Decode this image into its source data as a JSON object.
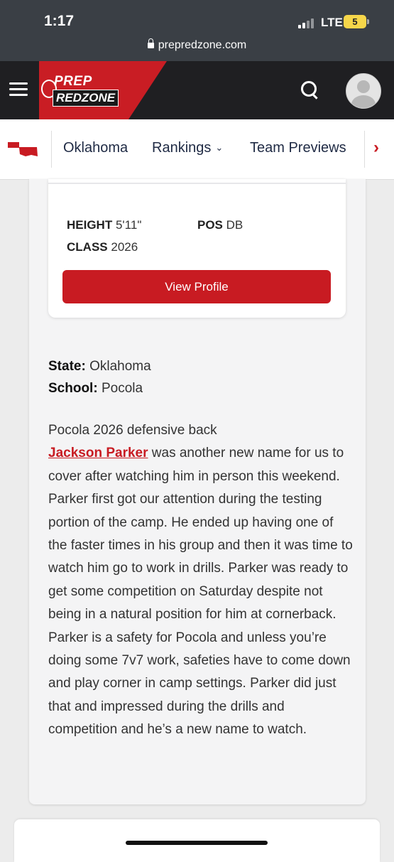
{
  "status_bar": {
    "time": "1:17",
    "network": "LTE",
    "battery": "5",
    "url": "prepredzone.com"
  },
  "header": {
    "logo_line1": "PREP",
    "logo_line2": "REDZONE",
    "brand_red": "#c91d24"
  },
  "subnav": {
    "state_icon": "oklahoma-state-icon",
    "items": [
      "Oklahoma",
      "Rankings",
      "Team Previews"
    ],
    "rankings_chevron": "⌄",
    "next_arrow": "›"
  },
  "player_card": {
    "height_label": "HEIGHT",
    "height_value": "5'11\"",
    "pos_label": "POS",
    "pos_value": "DB",
    "class_label": "CLASS",
    "class_value": "2026",
    "button_label": "View Profile"
  },
  "article": {
    "state_label": "State:",
    "state_value": "Oklahoma",
    "school_label": "School:",
    "school_value": "Pocola",
    "intro": "Pocola 2026 defensive back",
    "player_name": "Jackson Parker",
    "body": " was another new name for us to cover after watching him in person this weekend. Parker first got our attention during the testing portion of the camp. He ended up having one of the faster times in his group and then it was time to watch him go to work in drills. Parker was ready to get some competition on Saturday despite not being in a natural position for him at cornerback. Parker is a safety for Pocola and unless you’re doing some 7v7 work, safeties have to come down and play corner in camp settings. Parker did just that and impressed during the drills and competition and he’s a new name to watch."
  }
}
